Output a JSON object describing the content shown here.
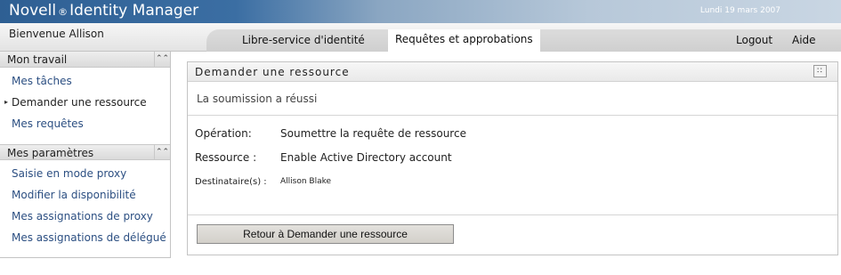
{
  "header": {
    "brand_name": "Novell",
    "brand_reg": "®",
    "product": "Identity Manager",
    "date": "Lundi 19 mars 2007"
  },
  "nav": {
    "welcome": "Bienvenue Allison",
    "tabs": [
      {
        "label": "Libre-service d'identité",
        "active": false
      },
      {
        "label": "Requêtes et approbations",
        "active": true
      }
    ],
    "logout": "Logout",
    "help": "Aide"
  },
  "sidebar": {
    "sections": [
      {
        "title": "Mon travail",
        "collapse_icon": "double-chevron-up-icon",
        "items": [
          {
            "label": "Mes tâches",
            "active": false
          },
          {
            "label": "Demander une ressource",
            "active": true
          },
          {
            "label": "Mes requêtes",
            "active": false
          }
        ]
      },
      {
        "title": "Mes paramètres",
        "collapse_icon": "double-chevron-up-icon",
        "items": [
          {
            "label": "Saisie en mode proxy"
          },
          {
            "label": "Modifier la disponibilité"
          },
          {
            "label": "Mes assignations de proxy"
          },
          {
            "label": "Mes assignations de délégué"
          }
        ]
      }
    ]
  },
  "panel": {
    "title": "Demander une ressource",
    "menu_icon": "panel-menu-icon",
    "message": "La soumission a réussi",
    "fields": [
      {
        "label": "Opération:",
        "value": "Soumettre la requête de ressource"
      },
      {
        "label": "Ressource :",
        "value": "Enable Active Directory account"
      },
      {
        "label": "Destinataire(s) :",
        "value": "Allison Blake"
      }
    ],
    "back_button": "Retour à Demander une ressource"
  },
  "colors": {
    "header_blue": "#2e5f93",
    "link_blue": "#2c4f82",
    "tabstrip_gray": "#d5d5d5",
    "button_face": "#dad7d2"
  }
}
